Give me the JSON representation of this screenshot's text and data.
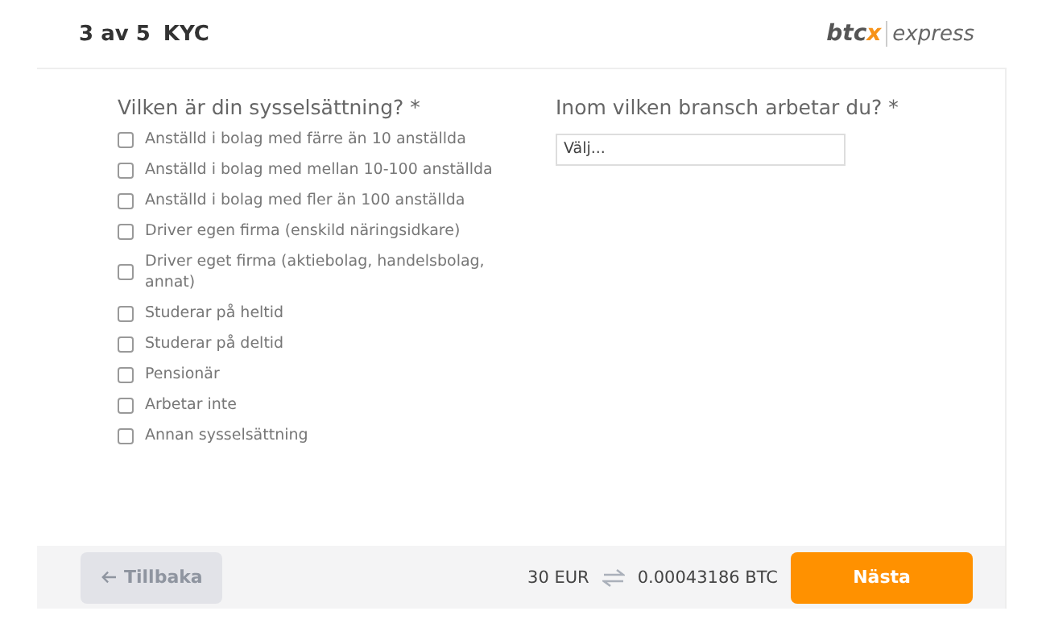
{
  "header": {
    "step": "3 av 5",
    "title": "KYC",
    "logo": {
      "brand": "btc",
      "accent": "x",
      "product": "express"
    }
  },
  "employment": {
    "question": "Vilken är din sysselsättning? *",
    "options": [
      {
        "label": "Anställd i bolag med färre än 10 anställda",
        "checked": false
      },
      {
        "label": "Anställd i bolag med mellan 10-100 anställda",
        "checked": false
      },
      {
        "label": "Anställd i bolag med fler än 100 anställda",
        "checked": false
      },
      {
        "label": "Driver egen firma (enskild näringsidkare)",
        "checked": false
      },
      {
        "label": "Driver eget firma (aktiebolag, handelsbolag, annat)",
        "checked": false
      },
      {
        "label": "Studerar på heltid",
        "checked": false
      },
      {
        "label": "Studerar på deltid",
        "checked": false
      },
      {
        "label": "Pensionär",
        "checked": false
      },
      {
        "label": "Arbetar inte",
        "checked": false
      },
      {
        "label": "Annan sysselsättning",
        "checked": false
      }
    ]
  },
  "industry": {
    "question": "Inom vilken bransch arbetar du? *",
    "placeholder": "Välj..."
  },
  "footer": {
    "back": {
      "label": "Tillbaka",
      "disabled": true
    },
    "amount": "30 EUR",
    "converted": "0.00043186 BTC",
    "next": {
      "label": "Nästa"
    }
  }
}
